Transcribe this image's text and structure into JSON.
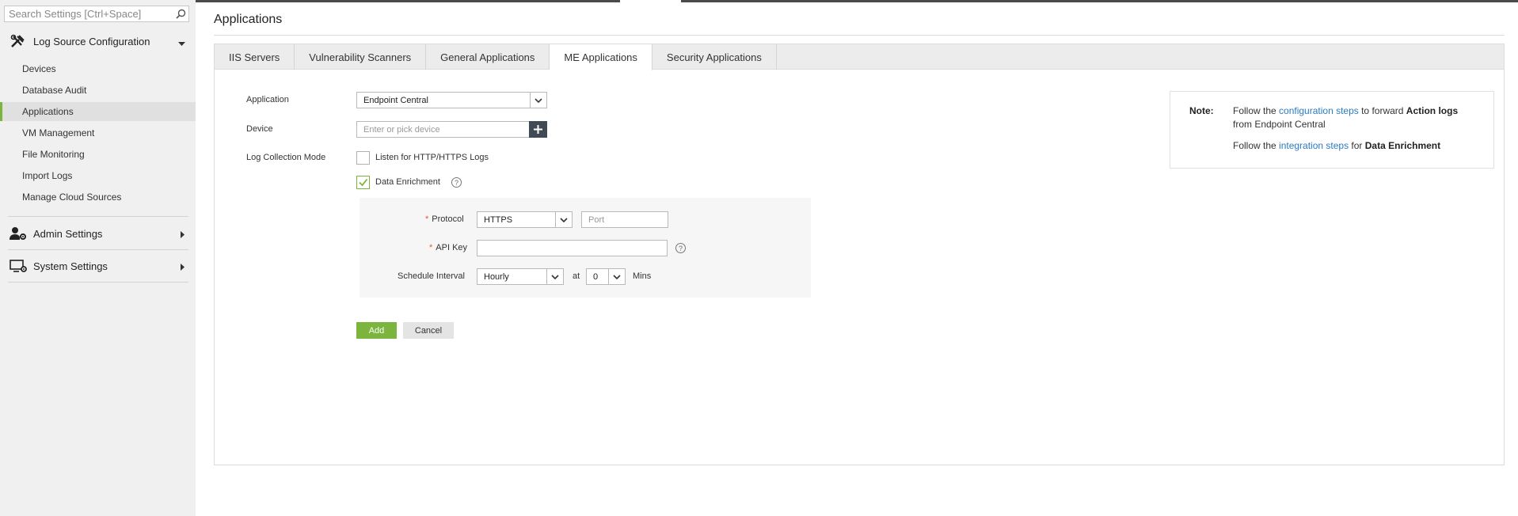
{
  "search": {
    "placeholder": "Search Settings [Ctrl+Space]"
  },
  "sidebar": {
    "log_source": {
      "title": "Log Source Configuration",
      "items": [
        {
          "label": "Devices"
        },
        {
          "label": "Database Audit"
        },
        {
          "label": "Applications"
        },
        {
          "label": "VM Management"
        },
        {
          "label": "File Monitoring"
        },
        {
          "label": "Import Logs"
        },
        {
          "label": "Manage Cloud Sources"
        }
      ]
    },
    "admin": {
      "title": "Admin Settings"
    },
    "system": {
      "title": "System Settings"
    }
  },
  "page": {
    "title": "Applications"
  },
  "tabs": [
    {
      "label": "IIS Servers"
    },
    {
      "label": "Vulnerability Scanners"
    },
    {
      "label": "General Applications"
    },
    {
      "label": "ME Applications"
    },
    {
      "label": "Security Applications"
    }
  ],
  "form": {
    "application_label": "Application",
    "application_value": "Endpoint Central",
    "device_label": "Device",
    "device_placeholder": "Enter or pick device",
    "mode_label": "Log Collection Mode",
    "listen_label": "Listen for HTTP/HTTPS Logs",
    "enrichment_label": "Data Enrichment",
    "protocol_label": "Protocol",
    "protocol_value": "HTTPS",
    "port_placeholder": "Port",
    "apikey_label": "API Key",
    "schedule_label": "Schedule Interval",
    "schedule_value": "Hourly",
    "at_label": "at",
    "minute_value": "0",
    "mins_label": "Mins",
    "add_label": "Add",
    "cancel_label": "Cancel",
    "required_mark": "*",
    "help_glyph": "?"
  },
  "note": {
    "title": "Note:",
    "line1_prefix": "Follow the ",
    "line1_link": "configuration steps",
    "line1_mid": " to forward ",
    "line1_bold": "Action logs",
    "line1_suffix": "from Endpoint Central",
    "line2_prefix": "Follow the ",
    "line2_link": "integration steps",
    "line2_mid": " for ",
    "line2_bold": "Data Enrichment"
  },
  "colors": {
    "accent": "#7bb53d",
    "link": "#2b7bc1",
    "dark_button": "#3f4a54",
    "required": "#e05a2b"
  },
  "icons": [
    "search-icon",
    "tools-icon",
    "admin-user-gear-icon",
    "monitor-gear-icon",
    "chevron-down-icon",
    "caret-right-icon",
    "plus-icon",
    "help-icon",
    "check-icon"
  ]
}
